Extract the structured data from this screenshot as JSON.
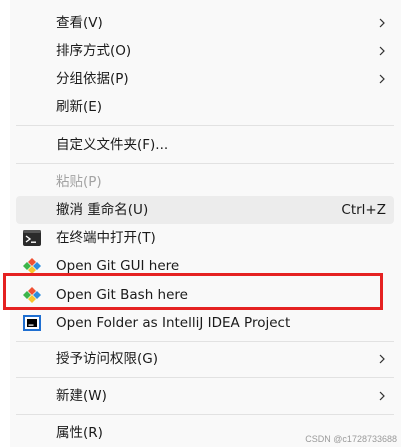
{
  "menu": {
    "view": "查看(V)",
    "sort_by": "排序方式(O)",
    "group_by": "分组依据(P)",
    "refresh": "刷新(E)",
    "customize_folder": "自定义文件夹(F)...",
    "paste": "粘贴(P)",
    "undo_rename": "撤消 重命名(U)",
    "undo_shortcut": "Ctrl+Z",
    "open_terminal": "在终端中打开(T)",
    "git_gui": "Open Git GUI here",
    "git_bash": "Open Git Bash here",
    "intellij_project": "Open Folder as IntelliJ IDEA Project",
    "give_access": "授予访问权限(G)",
    "new": "新建(W)",
    "properties": "属性(R)"
  },
  "watermark": "CSDN @c1728733688",
  "colors": {
    "menu_background": "#f9f9f9",
    "hover_background": "#ececec",
    "highlight_border": "#e52222",
    "disabled_text": "#a3a3a3",
    "git_orange": "#f05133",
    "git_green": "#3db54a",
    "git_blue": "#2f8ddc",
    "git_yellow": "#f7c52e"
  },
  "icons": {
    "terminal": "terminal-icon",
    "git": "git-icon",
    "intellij": "intellij-icon",
    "submenu": "chevron-right-icon"
  }
}
